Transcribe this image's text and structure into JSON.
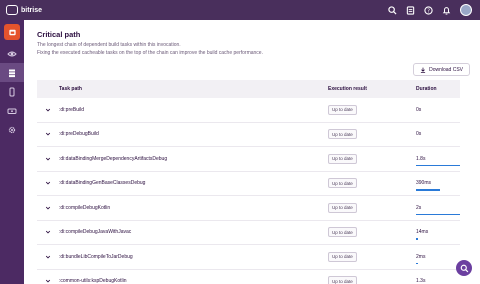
{
  "app": {
    "name": "bitrise"
  },
  "header_icons": [
    "search-icon",
    "document-icon",
    "help-icon",
    "bell-icon",
    "avatar"
  ],
  "sidebar": {
    "items": [
      "app-icon",
      "eye-icon",
      "stack-icon",
      "phone-icon",
      "ticket-icon",
      "gear-icon"
    ]
  },
  "page": {
    "title": "Critical path",
    "description_1": "The longest chain of dependent build tasks within this invocation.",
    "description_2": "Fixing the executed cacheable tasks on the top of the chain can improve the build cache performance."
  },
  "download_label": "Download CSV",
  "table": {
    "headers": {
      "task_path": "Task path",
      "execution_result": "Execution result",
      "duration": "Duration"
    },
    "rows": [
      {
        "path": ":di:preBuild",
        "result": "Up to date",
        "duration": "0s",
        "fraction": 0
      },
      {
        "path": ":di:preDebugBuild",
        "result": "Up to date",
        "duration": "0s",
        "fraction": 0
      },
      {
        "path": ":di:dataBindingMergeDependencyArtifactsDebug",
        "result": "Up to date",
        "duration": "1.8s",
        "fraction": 1.0
      },
      {
        "path": ":di:dataBindingGenBaseClassesDebug",
        "result": "Up to date",
        "duration": "390ms",
        "fraction": 0.55
      },
      {
        "path": ":di:compileDebugKotlin",
        "result": "Up to date",
        "duration": "2s",
        "fraction": 1.0
      },
      {
        "path": ":di:compileDebugJavaWithJavac",
        "result": "Up to date",
        "duration": "14ms",
        "fraction": 0.05
      },
      {
        "path": ":di:bundleLibCompileToJarDebug",
        "result": "Up to date",
        "duration": "2ms",
        "fraction": 0.03
      },
      {
        "path": ":common-utils:kspDebugKotlin",
        "result": "Up to date",
        "duration": "1.3s",
        "fraction": 0.85
      }
    ]
  },
  "colors": {
    "topbar": "#492f5c",
    "sidebar": "#4c2a63",
    "accent": "#6b3fa0",
    "bar": "#2a7ad8"
  }
}
